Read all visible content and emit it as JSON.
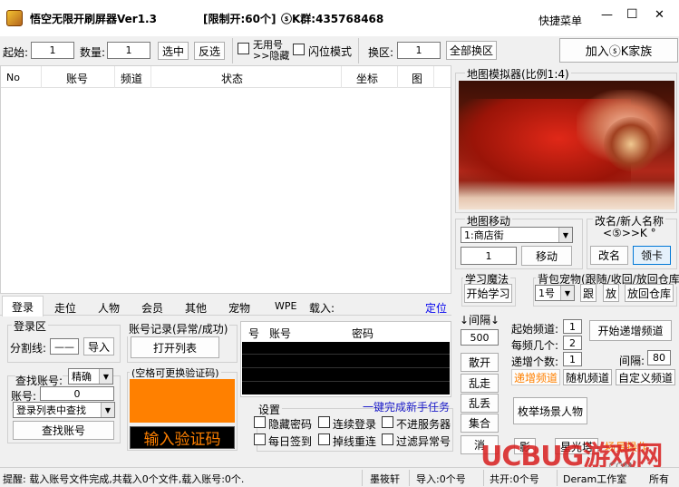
{
  "titlebar": {
    "title": "悟空无限开刷屏器Ver1.3",
    "limit": "[限制开:60个]",
    "qq_group": "ⓢK群:435768468",
    "quick_menu": "快捷菜单",
    "minimize": "—",
    "maximize": "☐",
    "close": "✕"
  },
  "toolbar": {
    "start_label": "起始:",
    "start_value": "1",
    "count_label": "数量:",
    "count_value": "1",
    "select_btn": "选中",
    "invert_btn": "反选",
    "hide_useless_line1": "无用号",
    "hide_useless_line2": ">>隐藏",
    "flash_mode": "闪位模式",
    "switch_area_label": "换区:",
    "switch_area_value": "1",
    "switch_all_btn": "全部换区",
    "join_family_btn": "加入ⓢK家族"
  },
  "table": {
    "columns": [
      "No",
      "账号",
      "频道",
      "状态",
      "坐标",
      "图"
    ]
  },
  "tabs": [
    "登录",
    "走位",
    "人物",
    "会员",
    "其他",
    "宠物",
    "WPE",
    "载入:"
  ],
  "tab_locate": "定位",
  "login_area": {
    "title": "登录区",
    "split_label": "分割线:",
    "split_value": "——",
    "import_btn": "导入"
  },
  "account_record": {
    "title": "账号记录(异常/成功)",
    "open_btn": "打开列表"
  },
  "account_table": {
    "columns": [
      "号",
      "账号",
      "密码"
    ]
  },
  "find_account": {
    "label": "查找账号:",
    "mode": "精确",
    "account_label": "账号:",
    "account_value": "0",
    "find_in_list": "登录列表中查找",
    "find_btn": "查找账号"
  },
  "captcha": {
    "title": "(空格可更换验证码)",
    "input_btn": "输入验证码",
    "color": "#ff8000"
  },
  "settings": {
    "title": "设置",
    "newbie_link": "一键完成新手任务",
    "hide_password": "隐藏密码",
    "continuous_login": "连续登录",
    "no_server": "不进服务器",
    "daily_checkin": "每日签到",
    "reconnect": "掉线重连",
    "filter_abnormal": "过滤异常号"
  },
  "interval": {
    "label": "↓间隔↓",
    "value": "500",
    "scatter": "散开",
    "random_walk": "乱走",
    "random_drop": "乱丢",
    "gather": "集合",
    "cancel": "消"
  },
  "map_simulator": {
    "title": "地图模拟器(比例1:4)"
  },
  "map_move": {
    "title": "地图移动",
    "location": "1:商店街",
    "value": "1",
    "move_btn": "移动"
  },
  "rename": {
    "title": "改名/新人名称",
    "name": "<⑤>>K °",
    "rename_btn": "改名",
    "claim_btn": "领卡"
  },
  "learn_magic": {
    "title": "学习魔法",
    "start_btn": "开始学习"
  },
  "bag_pet": {
    "title": "背包宠物(跟随/收回/放回仓库)",
    "slot": "1号",
    "follow_btn": "跟",
    "release_btn": "放",
    "return_btn": "放回仓库"
  },
  "channel": {
    "start_label": "起始频道:",
    "start_value": "1",
    "per_label": "每频几个:",
    "per_value": "2",
    "inc_label": "递增个数:",
    "inc_value": "1",
    "interval_label": "间隔:",
    "interval_value": "80",
    "start_inc_btn": "开始递增频道",
    "inc_channel": "递增频道",
    "random_channel": "随机频道",
    "custom_channel": "自定义频道",
    "enum_btn": "枚举场景人物",
    "extra1": "影",
    "extra2": "星光塔",
    "extra3": "场景操作"
  },
  "statusbar": {
    "hint": "提醒: 载入账号文件完成,共载入0个文件,载入账号:0个.",
    "user": "墨筱轩",
    "loaded": "导入:0个号",
    "opened": "共开:0个号",
    "brand": "Deram工作室",
    "rights": "所有"
  },
  "watermark": {
    "text": "UCBUG游戏网",
    "sub": ".COM"
  }
}
